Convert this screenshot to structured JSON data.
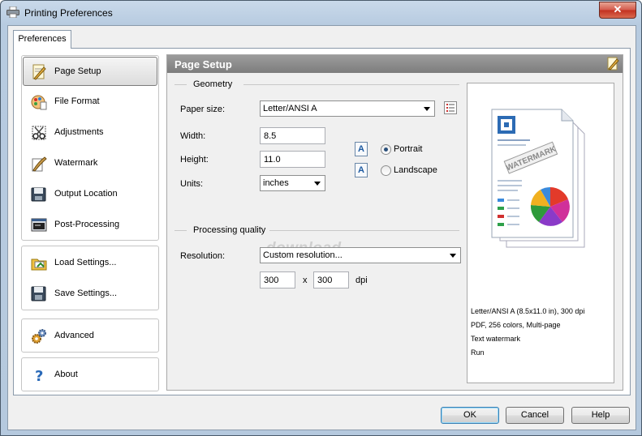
{
  "window": {
    "title": "Printing Preferences",
    "close_glyph": "✕"
  },
  "tab": {
    "label": "Preferences"
  },
  "nav": {
    "main": [
      {
        "label": "Page Setup",
        "icon": "page-setup-icon"
      },
      {
        "label": "File Format",
        "icon": "file-format-icon"
      },
      {
        "label": "Adjustments",
        "icon": "adjustments-icon"
      },
      {
        "label": "Watermark",
        "icon": "watermark-icon"
      },
      {
        "label": "Output Location",
        "icon": "output-location-icon"
      },
      {
        "label": "Post-Processing",
        "icon": "post-processing-icon"
      }
    ],
    "settings": [
      {
        "label": "Load Settings...",
        "icon": "load-settings-icon"
      },
      {
        "label": "Save Settings...",
        "icon": "save-settings-icon"
      }
    ],
    "advanced": {
      "label": "Advanced",
      "icon": "gears-icon"
    },
    "about": {
      "label": "About",
      "icon": "help-icon"
    }
  },
  "content": {
    "title": "Page Setup",
    "geometry": {
      "section": "Geometry",
      "paper_size_label": "Paper size:",
      "paper_size_value": "Letter/ANSI A",
      "width_label": "Width:",
      "width_value": "8.5",
      "height_label": "Height:",
      "height_value": "11.0",
      "units_label": "Units:",
      "units_value": "inches",
      "portrait_label": "Portrait",
      "landscape_label": "Landscape",
      "orientation_selected": "Portrait",
      "orientation_glyph": "A"
    },
    "quality": {
      "section": "Processing quality",
      "resolution_label": "Resolution:",
      "resolution_value": "Custom resolution...",
      "res_x": "300",
      "times": "x",
      "res_y": "300",
      "unit": "dpi"
    },
    "watermark_overlay": "download",
    "preview": {
      "lines": [
        "Letter/ANSI A (8.5x11.0 in), 300 dpi",
        "PDF, 256 colors, Multi-page",
        "Text watermark",
        "Run"
      ],
      "doc_watermark": "WATERMARK"
    }
  },
  "buttons": {
    "ok": "OK",
    "cancel": "Cancel",
    "help": "Help"
  },
  "colors": {
    "header": "#8a8a8a",
    "accent": "#3c7fb1",
    "close": "#c2301f"
  }
}
